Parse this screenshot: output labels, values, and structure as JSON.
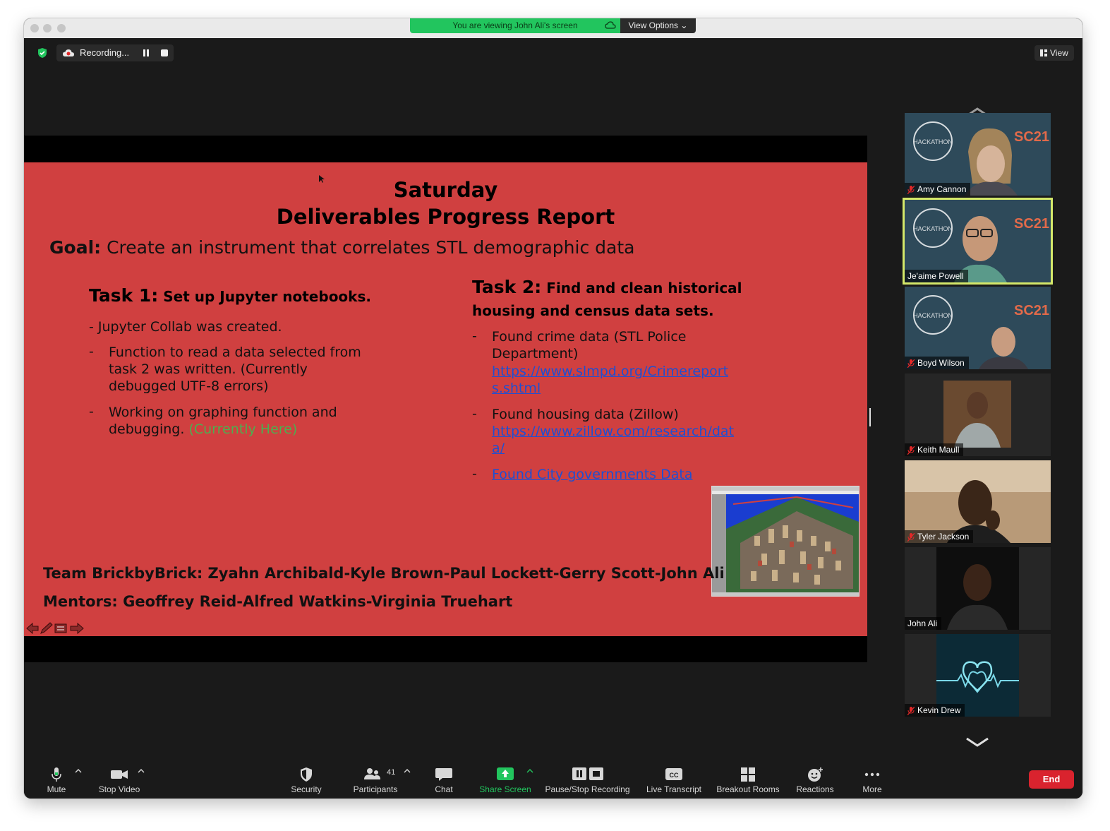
{
  "titlebar": {
    "viewing_text": "You are viewing John Ali's screen",
    "view_options": "View Options"
  },
  "header": {
    "recording_label": "Recording...",
    "view_label": "View"
  },
  "slide": {
    "title_line1": "Saturday",
    "title_line2": "Deliverables Progress Report",
    "goal_label": "Goal:",
    "goal_text": " Create an instrument that correlates STL demographic data",
    "task1": {
      "label": "Task 1:",
      "title": " Set up Jupyter notebooks.",
      "line1": "- Jupyter Collab was created.",
      "bullet1": "Function to read a data selected from task 2 was written. (Currently debugged UTF-8 errors)",
      "bullet2": "Working on graphing function and debugging.",
      "bullet2_status": "(Currently Here)"
    },
    "task2": {
      "label": "Task 2:",
      "title_line1": " Find and clean historical",
      "title_line2": "housing and census data sets.",
      "bullet1_text": "Found crime data (STL Police Department)",
      "bullet1_link": "https://www.slmpd.org/Crimereports.shtml",
      "bullet2_text": "Found housing data (Zillow)",
      "bullet2_link": "https://www.zillow.com/research/data/",
      "bullet3_link": "Found City governments Data"
    },
    "team": "Team BrickbyBrick: Zyahn Archibald-Kyle Brown-Paul Lockett-Gerry Scott-John Ali",
    "mentors": "Mentors: Geoffrey Reid-Alfred Watkins-Virginia Truehart",
    "dash": "-"
  },
  "participants": [
    {
      "name": "Amy Cannon",
      "muted": true
    },
    {
      "name": "Je'aime Powell",
      "muted": false
    },
    {
      "name": "Boyd Wilson",
      "muted": true
    },
    {
      "name": "Keith Maull",
      "muted": true
    },
    {
      "name": "Tyler Jackson",
      "muted": true
    },
    {
      "name": "John Ali",
      "muted": false
    },
    {
      "name": "Kevin Drew",
      "muted": true
    }
  ],
  "toolbar": {
    "mute": "Mute",
    "stop_video": "Stop Video",
    "security": "Security",
    "participants": "Participants",
    "participants_count": "41",
    "chat": "Chat",
    "share_screen": "Share Screen",
    "pause_stop_recording": "Pause/Stop Recording",
    "live_transcript": "Live Transcript",
    "breakout_rooms": "Breakout Rooms",
    "reactions": "Reactions",
    "more": "More",
    "end": "End"
  },
  "colors": {
    "slide_bg": "#d04040",
    "banner_green": "#22c55e",
    "share_green": "#22c55e",
    "end_red": "#d9232e",
    "active_speaker": "#d4e86a",
    "link_blue": "#1f4fd1"
  }
}
